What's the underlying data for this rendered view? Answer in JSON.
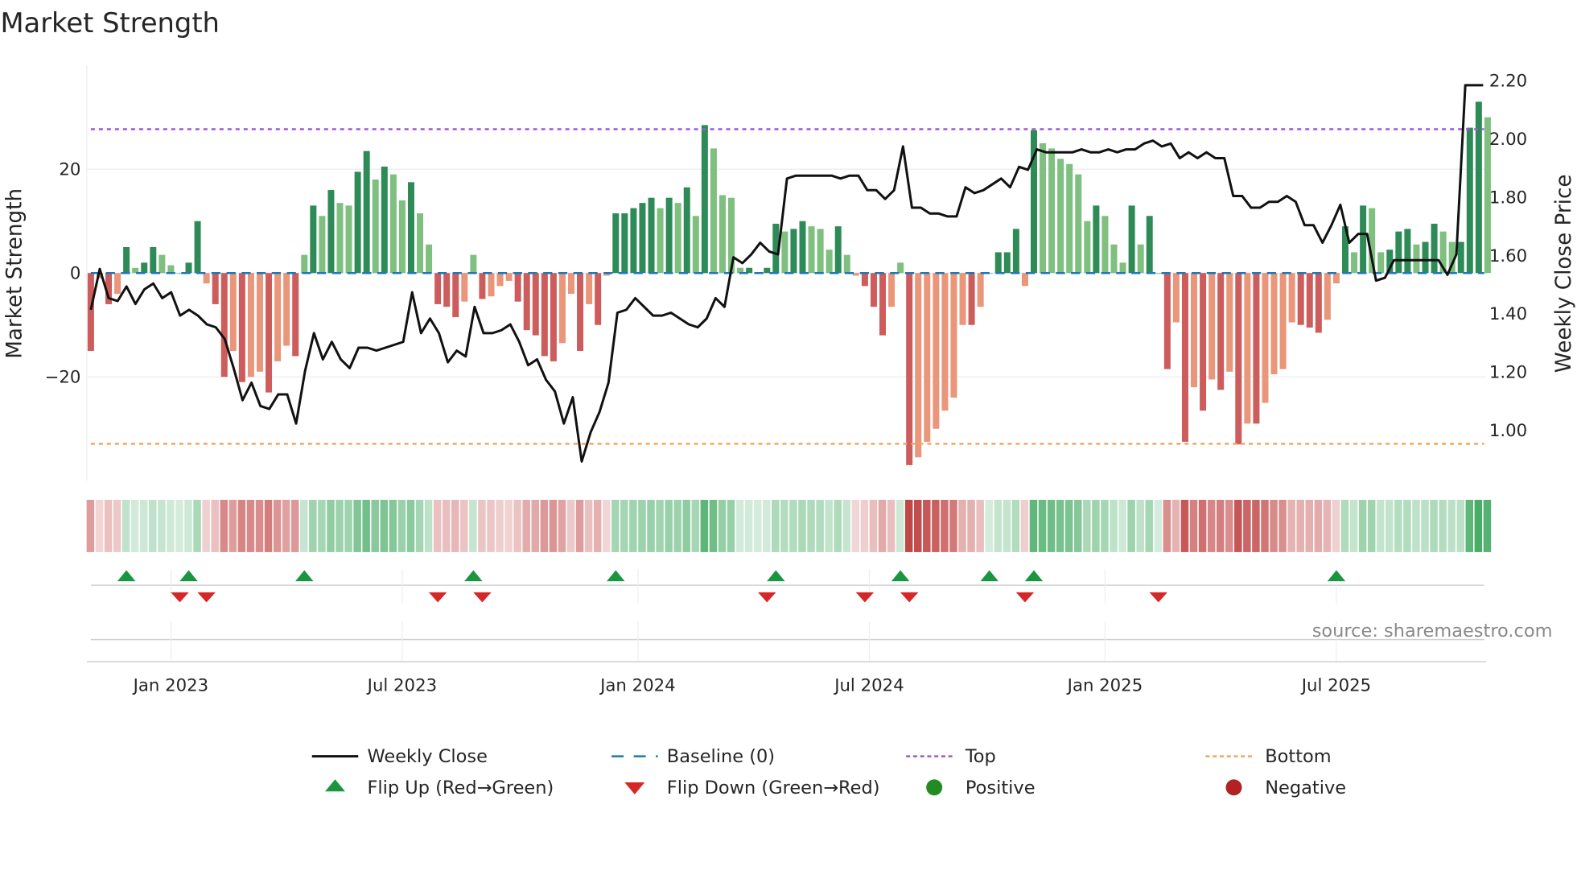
{
  "chart_data": {
    "type": "bar",
    "title": "Market Strength",
    "ylabel": "Market Strength",
    "y2label": "Weekly Close Price",
    "ylim": [
      -40,
      40
    ],
    "y2lim": [
      0.824,
      2.248
    ],
    "yticks": [
      {
        "v": 20,
        "label": "20"
      },
      {
        "v": 0,
        "label": "0"
      },
      {
        "v": -20,
        "label": "−20"
      }
    ],
    "y2ticks": [
      {
        "v": 2.2,
        "label": "2.20"
      },
      {
        "v": 2.0,
        "label": "2.00"
      },
      {
        "v": 1.8,
        "label": "1.80"
      },
      {
        "v": 1.6,
        "label": "1.60"
      },
      {
        "v": 1.4,
        "label": "1.40"
      },
      {
        "v": 1.2,
        "label": "1.20"
      },
      {
        "v": 1.0,
        "label": "1.00"
      }
    ],
    "xticks": [
      {
        "week": 9,
        "label": "Jan 2023"
      },
      {
        "week": 35,
        "label": "Jul 2023"
      },
      {
        "week": 61.5,
        "label": "Jan 2024"
      },
      {
        "week": 87.5,
        "label": "Jul 2024"
      },
      {
        "week": 114,
        "label": "Jan 2025"
      },
      {
        "week": 140,
        "label": "Jul 2025"
      }
    ],
    "top_level": 27.7,
    "bottom_level": -32.9,
    "baseline": 0,
    "strength": [
      -15,
      -1,
      -6,
      -4,
      5,
      1,
      2,
      5,
      3.5,
      1.5,
      0,
      2,
      10,
      -2,
      -6,
      -20,
      -15,
      -21,
      -20,
      -19,
      -23,
      -17,
      -14,
      -16,
      3.5,
      13,
      11,
      16,
      13.5,
      13,
      19.5,
      23.5,
      18,
      20.5,
      19,
      14,
      17.5,
      11.5,
      5.5,
      -6,
      -6.5,
      -8.5,
      -5.5,
      3.5,
      -5,
      -4.5,
      -2.5,
      -1.5,
      -5.5,
      -11,
      -12,
      -16,
      -17,
      -13.5,
      -4,
      -15,
      -6,
      -10,
      -0.5,
      11.5,
      11.5,
      12.5,
      13.5,
      14.5,
      12.5,
      14.5,
      13.5,
      16.5,
      11,
      28.5,
      24,
      15,
      14.5,
      1,
      1,
      0,
      1,
      9.5,
      8,
      8.5,
      10,
      9,
      8.5,
      4.5,
      9,
      3.5,
      -0.5,
      -2.5,
      -6.5,
      -12,
      -6.5,
      2,
      -37,
      -35.5,
      -32.5,
      -30,
      -26.5,
      -24,
      -10,
      -10,
      -6.5,
      0,
      4,
      4,
      8.5,
      -2.5,
      27.5,
      25,
      24,
      22,
      21,
      19,
      10,
      13,
      11,
      5.5,
      2,
      13,
      5.5,
      11,
      0,
      -18.5,
      -9.5,
      -32.5,
      -22,
      -26.5,
      -20.5,
      -22.5,
      -19,
      -33,
      -29,
      -29,
      -25,
      -19.5,
      -18.5,
      -9.5,
      -10,
      -10.5,
      -11.5,
      -9,
      -2,
      9,
      4,
      13,
      12.5,
      4,
      4.5,
      8,
      8.5,
      5.5,
      6,
      9.5,
      8,
      6,
      6,
      28,
      33,
      30
    ],
    "weekly_close": [
      1.41,
      1.55,
      1.45,
      1.44,
      1.49,
      1.43,
      1.48,
      1.5,
      1.45,
      1.47,
      1.39,
      1.41,
      1.39,
      1.36,
      1.35,
      1.31,
      1.21,
      1.1,
      1.16,
      1.08,
      1.07,
      1.12,
      1.12,
      1.02,
      1.2,
      1.33,
      1.24,
      1.3,
      1.24,
      1.21,
      1.28,
      1.28,
      1.27,
      1.28,
      1.29,
      1.3,
      1.47,
      1.33,
      1.38,
      1.33,
      1.23,
      1.27,
      1.25,
      1.42,
      1.33,
      1.33,
      1.34,
      1.36,
      1.3,
      1.22,
      1.24,
      1.17,
      1.13,
      1.02,
      1.11,
      0.89,
      0.99,
      1.06,
      1.16,
      1.4,
      1.41,
      1.45,
      1.42,
      1.39,
      1.39,
      1.4,
      1.38,
      1.36,
      1.35,
      1.38,
      1.45,
      1.42,
      1.59,
      1.57,
      1.6,
      1.64,
      1.61,
      1.6,
      1.86,
      1.87,
      1.87,
      1.87,
      1.87,
      1.87,
      1.86,
      1.87,
      1.87,
      1.82,
      1.82,
      1.79,
      1.82,
      1.97,
      1.76,
      1.76,
      1.74,
      1.74,
      1.73,
      1.73,
      1.83,
      1.81,
      1.82,
      1.84,
      1.86,
      1.83,
      1.9,
      1.89,
      1.96,
      1.95,
      1.95,
      1.95,
      1.95,
      1.96,
      1.95,
      1.95,
      1.96,
      1.95,
      1.96,
      1.96,
      1.98,
      1.99,
      1.97,
      1.98,
      1.93,
      1.95,
      1.93,
      1.95,
      1.93,
      1.93,
      1.8,
      1.8,
      1.76,
      1.76,
      1.78,
      1.78,
      1.8,
      1.78,
      1.7,
      1.7,
      1.64,
      1.7,
      1.77,
      1.64,
      1.67,
      1.67,
      1.51,
      1.52,
      1.58,
      1.58,
      1.58,
      1.58,
      1.58,
      1.58,
      1.53,
      1.6,
      2.18,
      2.18,
      2.18
    ],
    "flip_up_weeks": [
      4,
      11,
      24,
      43,
      59,
      77,
      91,
      101,
      106,
      140
    ],
    "flip_down_weeks": [
      10,
      13,
      39,
      44,
      76,
      87,
      92,
      105,
      120
    ],
    "colors": {
      "pos_strong": "#2e8b57",
      "pos_weak": "#7fbf7f",
      "neg_strong": "#cd5c5c",
      "neg_weak": "#e9967a",
      "baseline": "#1f77b4",
      "top": "#9b59d0",
      "bottom": "#f4a460",
      "flip_up": "#1a9641",
      "flip_down": "#d62728",
      "positive": "#228b22",
      "negative": "#b22222"
    },
    "legend": [
      {
        "label": "Weekly Close",
        "kind": "line"
      },
      {
        "label": "Baseline (0)",
        "kind": "dash"
      },
      {
        "label": "Top",
        "kind": "dot-top"
      },
      {
        "label": "Bottom",
        "kind": "dot-bottom"
      },
      {
        "label": "Flip Up (Red→Green)",
        "kind": "tri-up"
      },
      {
        "label": "Flip Down (Green→Red)",
        "kind": "tri-down"
      },
      {
        "label": "Positive",
        "kind": "circle-pos"
      },
      {
        "label": "Negative",
        "kind": "circle-neg"
      }
    ],
    "source": "source: sharemaestro.com"
  }
}
